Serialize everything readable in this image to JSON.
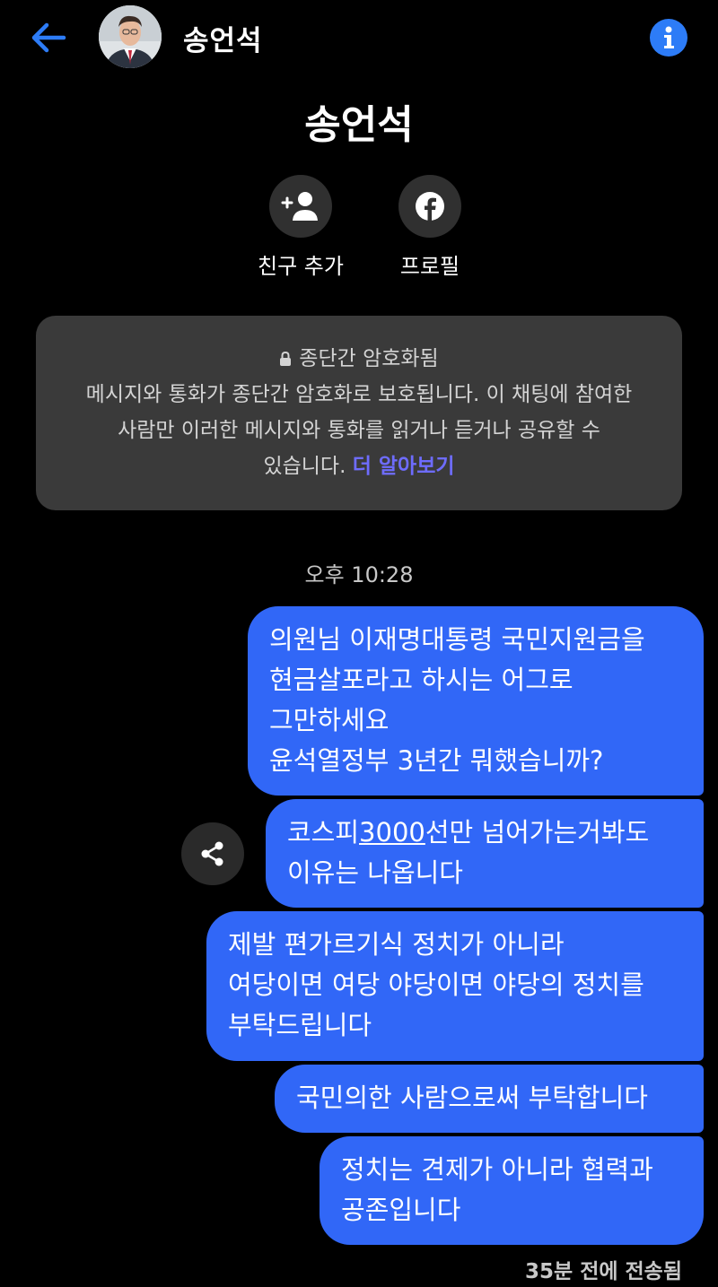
{
  "header": {
    "contact_name": "송언석"
  },
  "profile": {
    "name": "송언석",
    "actions": [
      {
        "label": "친구 추가",
        "icon": "add-friend-icon"
      },
      {
        "label": "프로필",
        "icon": "facebook-icon"
      }
    ]
  },
  "encryption": {
    "title": "종단간 암호화됨",
    "body_line1": "메시지와 통화가 종단간 암호화로 보호됩니다. 이 채팅에 참여한",
    "body_line2": "사람만 이러한 메시지와 통화를 읽거나 듣거나 공유할 수",
    "body_line3": "있습니다.",
    "link": "더 알아보기"
  },
  "conversation": {
    "timestamp": "오후 10:28",
    "messages": [
      {
        "text": "의원님 이재명대통령 국민지원금을\n현금살포라고 하시는  어그로\n그만하세요\n윤석열정부 3년간 뭐했습니까?"
      },
      {
        "text_before": "코스피",
        "text_link": "3000",
        "text_after": "선만 넘어가는거봐도\n이유는 나옵니다"
      },
      {
        "text": "제발 편가르기식 정치가 아니라\n여당이면 여당 야당이면 야당의 정치를\n부탁드립니다"
      },
      {
        "text": "국민의한 사람으로써 부탁합니다"
      },
      {
        "text": "정치는 견제가 아니라 협력과\n공존입니다"
      }
    ],
    "status": "35분 전에 전송됨"
  },
  "colors": {
    "background": "#000000",
    "bubble": "#3167f7",
    "accent": "#2d7cf7",
    "link": "#6e6cff",
    "card": "#3a3a3a"
  }
}
